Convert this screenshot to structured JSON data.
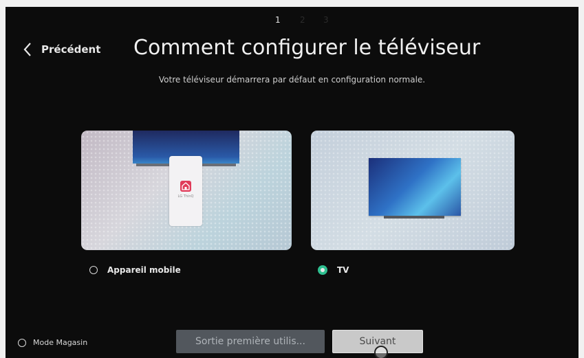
{
  "steps": [
    "1",
    "2",
    "3"
  ],
  "header": {
    "back_label": "Précédent",
    "title": "Comment configurer le téléviseur",
    "subtitle": "Votre téléviseur démarrera par défaut en configuration normale."
  },
  "cards": {
    "mobile_app_label": "LG ThinQ"
  },
  "options": {
    "mobile_label": "Appareil mobile",
    "mobile_selected": false,
    "tv_label": "TV",
    "tv_selected": true
  },
  "footer": {
    "store_mode_label": "Mode Magasin",
    "exit_button": "Sortie première utilis...",
    "next_button": "Suivant"
  },
  "colors": {
    "background": "#0c0c0c",
    "selected_radio": "#2fbf90",
    "next_button_bg": "#c9c9c9",
    "exit_button_bg": "#52575d"
  },
  "icons": [
    "chevron-left-icon",
    "home-app-icon",
    "radio-unselected-icon",
    "radio-selected-icon"
  ]
}
